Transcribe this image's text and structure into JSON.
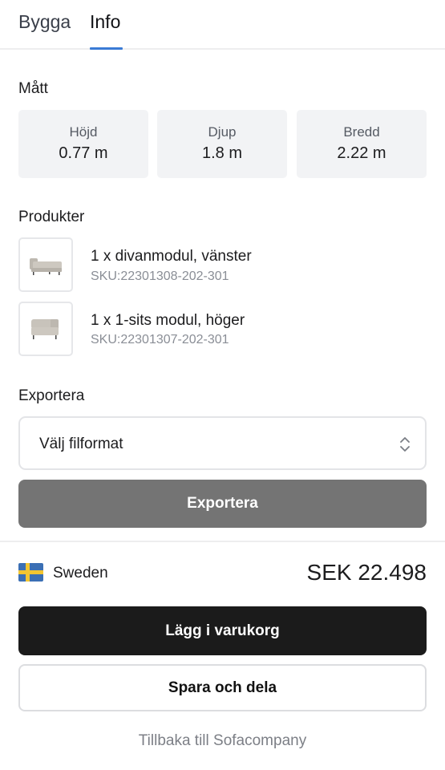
{
  "tabs": [
    {
      "label": "Bygga",
      "active": false
    },
    {
      "label": "Info",
      "active": true
    }
  ],
  "dimensions": {
    "title": "Mått",
    "items": [
      {
        "label": "Höjd",
        "value": "0.77 m"
      },
      {
        "label": "Djup",
        "value": "1.8 m"
      },
      {
        "label": "Bredd",
        "value": "2.22 m"
      }
    ]
  },
  "products": {
    "title": "Produkter",
    "items": [
      {
        "name": "1 x divanmodul, vänster",
        "sku": "SKU:22301308-202-301",
        "image_icon": "sofa-divan-icon"
      },
      {
        "name": "1 x 1-sits modul, höger",
        "sku": "SKU:22301307-202-301",
        "image_icon": "sofa-seat-icon"
      }
    ]
  },
  "export": {
    "title": "Exportera",
    "select_value": "Välj filformat",
    "button_label": "Exportera"
  },
  "footer": {
    "country": "Sweden",
    "flag_icon": "sweden-flag-icon",
    "price": "SEK 22.498",
    "add_to_cart": "Lägg i varukorg",
    "save_share": "Spara och dela",
    "back_link": "Tillbaka till Sofacompany"
  },
  "colors": {
    "accent": "#3a7bd5",
    "export_button": "#747474",
    "cart_button": "#1b1b1b",
    "dim_box_bg": "#f2f3f5"
  }
}
